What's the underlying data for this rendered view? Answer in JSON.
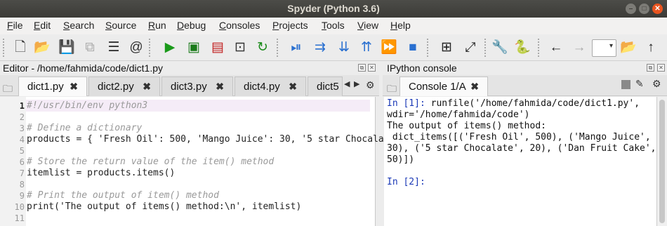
{
  "window": {
    "title": "Spyder (Python 3.6)"
  },
  "menubar": [
    "File",
    "Edit",
    "Search",
    "Source",
    "Run",
    "Debug",
    "Consoles",
    "Projects",
    "Tools",
    "View",
    "Help"
  ],
  "toolbar": {
    "icons": [
      "new-file-icon",
      "open-file-icon",
      "save-icon",
      "save-all-icon",
      "outline-icon",
      "at-icon",
      "run-icon",
      "run-cell-icon",
      "run-cell-advance-icon",
      "run-selection-icon",
      "rerun-icon",
      "debug-icon",
      "step-icon",
      "step-into-icon",
      "step-return-icon",
      "continue-icon",
      "stop-icon",
      "maximize-pane-icon",
      "fullscreen-icon",
      "preferences-icon",
      "python-path-icon",
      "back-icon",
      "forward-icon",
      "working-directory-input",
      "folder-icon",
      "parent-dir-icon"
    ]
  },
  "editor": {
    "title": "Editor - /home/fahmida/code/dict1.py",
    "tabs": [
      "dict1.py",
      "dict2.py",
      "dict3.py",
      "dict4.py",
      "dict5"
    ],
    "lines": [
      {
        "n": "1",
        "text": "#!/usr/bin/env python3"
      },
      {
        "n": "2",
        "text": ""
      },
      {
        "n": "3",
        "text": "# Define a dictionary"
      },
      {
        "n": "4",
        "text": "products = { 'Fresh Oil': 500, 'Mango Juice': 30, '5 star Chocala"
      },
      {
        "n": "5",
        "text": ""
      },
      {
        "n": "6",
        "text": "# Store the return value of the item() method"
      },
      {
        "n": "7",
        "text": "itemlist = products.items()"
      },
      {
        "n": "8",
        "text": ""
      },
      {
        "n": "9",
        "text": "# Print the output of item() method"
      },
      {
        "n": "10",
        "text": "print('The output of items() method:\\n', itemlist)"
      },
      {
        "n": "11",
        "text": ""
      }
    ]
  },
  "console": {
    "title": "IPython console",
    "tab": "Console 1/A",
    "prompt1": "In [1]:",
    "cmd1": " runfile('/home/fahmida/code/dict1.py',",
    "cmd1b": "wdir='/home/fahmida/code')",
    "out1": "The output of items() method:",
    "out2": " dict_items([('Fresh Oil', 500), ('Mango Juice',",
    "out3": "30), ('5 star Chocalate', 20), ('Dan Fruit Cake',",
    "out4": "50)])",
    "prompt2": "In [2]:"
  }
}
